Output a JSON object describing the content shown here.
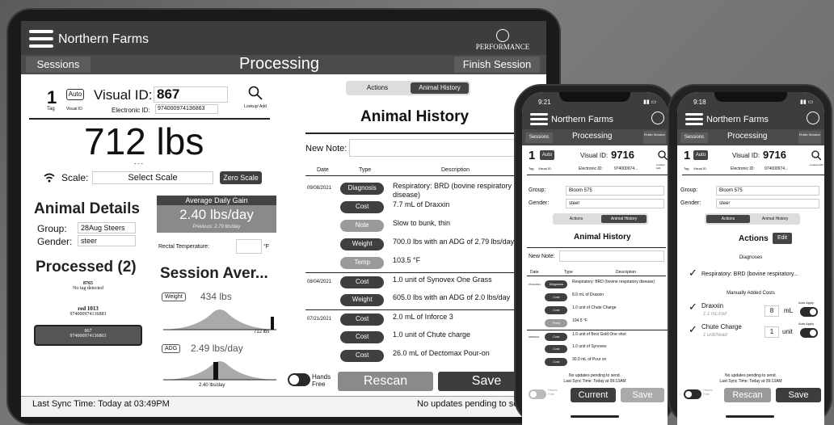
{
  "tablet": {
    "app_name": "Northern Farms",
    "brand": "PERFORMANCE",
    "sessions": "Sessions",
    "title": "Processing",
    "finish": "Finish Session",
    "tag_number": "1",
    "tag_label": "Tag",
    "auto": "Auto",
    "visual_id_small": "Visual ID",
    "visual_id_label": "Visual ID:",
    "visual_id": "867",
    "electronic_id_label": "Electronic ID:",
    "electronic_id": "974000974136863",
    "lookup": "Lookup/ Add",
    "weight": "712 lbs",
    "dashes": "- - -",
    "scale_label": "Scale:",
    "select_scale": "Select Scale",
    "zero_scale": "Zero Scale",
    "animal_details": "Animal Details",
    "group_label": "Group:",
    "group": "28Aug Steers",
    "gender_label": "Gender:",
    "gender": "steer",
    "adg_title": "Average Daily Gain",
    "adg_value": "2.40 lbs/day",
    "adg_previous": "Previous: 2.79 lbs/day",
    "rectal_temp": "Rectal Temperature:",
    "temp_unit": "°F",
    "processed": "Processed (2)",
    "processed_items": [
      {
        "id": "8765",
        "sub": "No tag detected"
      },
      {
        "id": "red 1013",
        "sub": "974000974136883"
      },
      {
        "id": "867",
        "sub": "974000974136863"
      }
    ],
    "session_avg": "Session Aver...",
    "weight_tag": "Weight",
    "weight_avg": "434 lbs",
    "weight_max": "712 lbs",
    "adg_tag": "ADG",
    "adg_avg": "2.49 lbs/day",
    "adg_axis": "2.40 lbs/day",
    "tab_actions": "Actions",
    "tab_history": "Animal History",
    "history_title": "Animal History",
    "new_note": "New Note:",
    "col_date": "Date",
    "col_type": "Type",
    "col_desc": "Description",
    "history": [
      {
        "date": "09/08/2021",
        "type": "Diagnosis",
        "desc": "Respiratory: BRD (bovine respiratory disease)"
      },
      {
        "date": "",
        "type": "Cost",
        "desc": "7.7 mL of Draxxin"
      },
      {
        "date": "",
        "type": "Note",
        "desc": "Slow to bunk, thin"
      },
      {
        "date": "",
        "type": "Weight",
        "desc": "700.0 lbs with an ADG of 2.79 lbs/day"
      },
      {
        "date": "",
        "type": "Temp",
        "desc": "103.5 °F"
      },
      {
        "date": "08/04/2021",
        "type": "Cost",
        "desc": "1.0 unit of Synovex One Grass"
      },
      {
        "date": "",
        "type": "Weight",
        "desc": "605.0 lbs with an ADG of 2.0 lbs/day"
      },
      {
        "date": "07/21/2021",
        "type": "Cost",
        "desc": "2.0 mL of Inforce 3"
      },
      {
        "date": "",
        "type": "Cost",
        "desc": "1.0 unit of Chute charge"
      },
      {
        "date": "",
        "type": "Cost",
        "desc": "26.0 mL of Dectomax Pour-on"
      }
    ],
    "hands_free": "Hands Free",
    "rescan": "Rescan",
    "save": "Save",
    "last_sync": "Last Sync Time: Today at 03:49PM",
    "pending": "No updates pending to se"
  },
  "phone1": {
    "time": "9:21",
    "app_name": "Northern Farms",
    "sessions": "Sessions",
    "title": "Processing",
    "finish": "Finish Session",
    "tag": "1",
    "auto": "Auto",
    "tag_label": "Tag",
    "vid_small": "Visual ID",
    "visual_id_label": "Visual ID:",
    "visual_id": "9716",
    "eid_label": "Electronic ID:",
    "eid": "974000974...",
    "lookup": "Lookup/ Add",
    "group_label": "Group:",
    "group": "Bloom 575",
    "gender_label": "Gender:",
    "gender": "steer",
    "tab_actions": "Actions",
    "tab_history": "Animal History",
    "history_title": "Animal History",
    "new_note": "New Note:",
    "col_date": "Date",
    "col_type": "Type",
    "col_desc": "Description",
    "history": [
      {
        "date": "07/01/2021",
        "type": "Diagnosis",
        "desc": "Respiratory: BRD (bovine respiratory disease)"
      },
      {
        "date": "",
        "type": "Cost",
        "desc": "8.0 mL of Draxxin"
      },
      {
        "date": "",
        "type": "Cost",
        "desc": "1.0 unit of Chute Charge"
      },
      {
        "date": "",
        "type": "Temp",
        "desc": "104.5 °F"
      },
      {
        "date": "6/08/2021",
        "type": "Cost",
        "desc": "1.0 unit of Bovi Gold One shot"
      },
      {
        "date": "",
        "type": "Cost",
        "desc": "1.0 unit of Synovex"
      },
      {
        "date": "",
        "type": "Cost",
        "desc": "30.0 mL of Pour on"
      }
    ],
    "pending": "No updates pending to send.",
    "last_sync": "Last Sync Time: Today at 09:13AM",
    "hands_free": "Hands Free",
    "current": "Current",
    "save": "Save"
  },
  "phone2": {
    "time": "9:18",
    "app_name": "Northern Farms",
    "sessions": "Sessions",
    "title": "Processing",
    "finish": "Finish Session",
    "tag": "1",
    "auto": "Auto",
    "tag_label": "Tag",
    "vid_small": "Visual ID",
    "visual_id_label": "Visual ID:",
    "visual_id": "9716",
    "eid_label": "Electronic ID:",
    "eid": "974000974...",
    "lookup": "Lookup/ Add",
    "group_label": "Group:",
    "group": "Bloom 575",
    "gender_label": "Gender:",
    "gender": "steer",
    "tab_actions": "Actions",
    "tab_history": "Animal History",
    "actions_title": "Actions",
    "edit": "Edit",
    "diagnoses": "Diagnoses",
    "diagnosis_item": "Respiratory: BRD (bovine respiratory...",
    "manual_costs": "Manually Added Costs",
    "auto_apply": "Auto Apply",
    "costs": [
      {
        "name": "Draxxin",
        "rate": "1.1 mL/cwt",
        "qty": "8",
        "unit": "mL"
      },
      {
        "name": "Chute Charge",
        "rate": "1 unit/head",
        "qty": "1",
        "unit": "unit"
      }
    ],
    "pending": "No updates pending to send.",
    "last_sync": "Last Sync Time: Today at 09:13AM",
    "hands_free": "Hands Free",
    "rescan": "Rescan",
    "save": "Save"
  }
}
